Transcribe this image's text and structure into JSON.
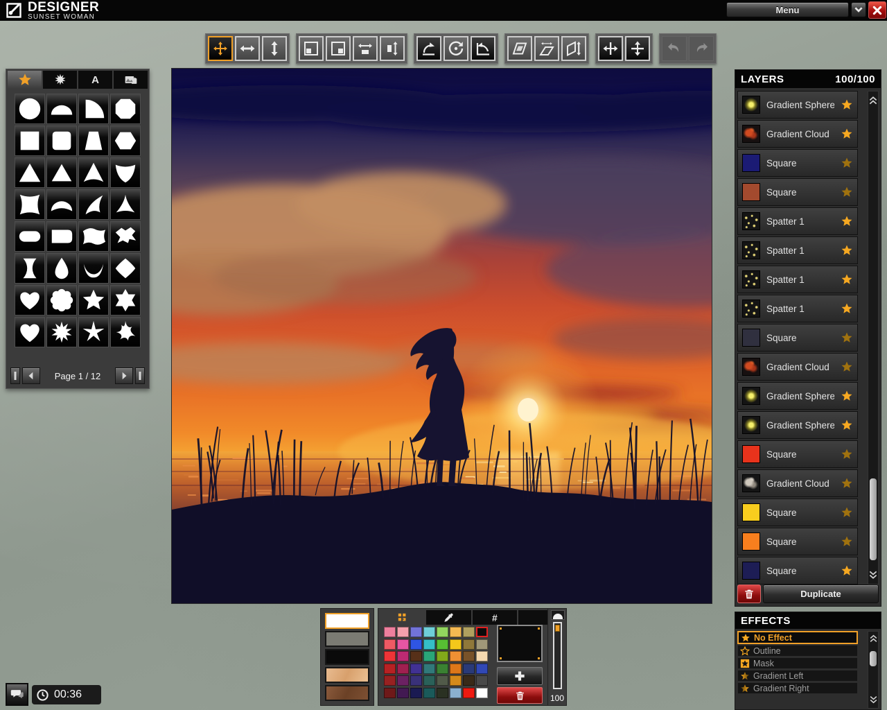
{
  "app": {
    "title": "DESIGNER",
    "subtitle": "SUNSET WOMAN"
  },
  "menu": {
    "label": "Menu"
  },
  "toolbar": {
    "groups": [
      {
        "name": "move",
        "buttons": [
          {
            "icon": "move",
            "state": "selected"
          },
          {
            "icon": "move-horizontal",
            "state": "normal"
          },
          {
            "icon": "move-vertical",
            "state": "normal"
          }
        ]
      },
      {
        "name": "scale",
        "buttons": [
          {
            "icon": "scale",
            "state": "normal"
          },
          {
            "icon": "scale-corner",
            "state": "normal"
          },
          {
            "icon": "scale-horizontal",
            "state": "normal"
          },
          {
            "icon": "scale-vertical",
            "state": "normal"
          }
        ]
      },
      {
        "name": "rotate",
        "buttons": [
          {
            "icon": "rotate-cw",
            "state": "dark"
          },
          {
            "icon": "rotate-free",
            "state": "normal"
          },
          {
            "icon": "rotate-ccw",
            "state": "dark"
          }
        ]
      },
      {
        "name": "skew",
        "buttons": [
          {
            "icon": "skew",
            "state": "normal"
          },
          {
            "icon": "skew-horizontal",
            "state": "normal"
          },
          {
            "icon": "skew-vertical",
            "state": "normal"
          }
        ]
      },
      {
        "name": "flip",
        "buttons": [
          {
            "icon": "flip-horizontal",
            "state": "dark"
          },
          {
            "icon": "flip-vertical",
            "state": "dark"
          }
        ]
      },
      {
        "name": "history",
        "buttons": [
          {
            "icon": "undo",
            "state": "disabled"
          },
          {
            "icon": "redo",
            "state": "disabled"
          }
        ]
      }
    ]
  },
  "shapes_panel": {
    "tabs": [
      {
        "name": "shapes",
        "icon": "star-tab",
        "active": true,
        "label": ""
      },
      {
        "name": "spatters",
        "icon": "spatter-tab",
        "active": false,
        "label": ""
      },
      {
        "name": "text",
        "icon": "text-tab",
        "active": false,
        "label": "A"
      },
      {
        "name": "images",
        "icon": "image-tab",
        "active": false,
        "label": ""
      }
    ],
    "shapes": [
      "circle",
      "semicircle",
      "quarter-circle",
      "octagon",
      "square",
      "rounded-square",
      "trapezoid",
      "hexagon",
      "triangle",
      "triangle-soft",
      "concave-triangle",
      "shield",
      "concave-square",
      "concave-arch",
      "swoosh",
      "three-point-star",
      "pill",
      "rounded-flag",
      "wavy-banner",
      "torn-banner",
      "concave-pillar",
      "teardrop",
      "crescent",
      "rounded-diamond",
      "heart",
      "flower",
      "star-5",
      "star-6",
      "heart-round",
      "burst-10",
      "star-5-sharp",
      "pinwheel-star"
    ],
    "pager": {
      "label": "Page 1 / 12"
    }
  },
  "layers": {
    "title": "LAYERS",
    "count": "100/100",
    "duplicate_label": "Duplicate",
    "items": [
      {
        "name": "Gradient Sphere",
        "thumb": "sphere",
        "star": "full"
      },
      {
        "name": "Gradient Cloud",
        "thumb": "cloud-red",
        "star": "full"
      },
      {
        "name": "Square",
        "thumb": "#1b1b74",
        "star": "dim"
      },
      {
        "name": "Square",
        "thumb": "#a34a2e",
        "star": "dim"
      },
      {
        "name": "Spatter 1",
        "thumb": "spatter",
        "star": "full"
      },
      {
        "name": "Spatter 1",
        "thumb": "spatter",
        "star": "full"
      },
      {
        "name": "Spatter 1",
        "thumb": "spatter",
        "star": "full"
      },
      {
        "name": "Spatter 1",
        "thumb": "spatter",
        "star": "full"
      },
      {
        "name": "Square",
        "thumb": "#30303f",
        "star": "dim"
      },
      {
        "name": "Gradient Cloud",
        "thumb": "cloud-red",
        "star": "dim"
      },
      {
        "name": "Gradient Sphere",
        "thumb": "sphere",
        "star": "full"
      },
      {
        "name": "Gradient Sphere",
        "thumb": "sphere",
        "star": "full"
      },
      {
        "name": "Square",
        "thumb": "#e8331c",
        "star": "dim"
      },
      {
        "name": "Gradient Cloud",
        "thumb": "cloud-gray",
        "star": "dim"
      },
      {
        "name": "Square",
        "thumb": "#f8cd1e",
        "star": "dim"
      },
      {
        "name": "Square",
        "thumb": "#f87f1e",
        "star": "dim"
      },
      {
        "name": "Square",
        "thumb": "#1d1d55",
        "star": "full"
      }
    ]
  },
  "effects": {
    "title": "EFFECTS",
    "items": [
      {
        "label": "No Effect",
        "icon": "star-filled",
        "selected": true
      },
      {
        "label": "Outline",
        "icon": "star-outline",
        "selected": false
      },
      {
        "label": "Mask",
        "icon": "star-square",
        "selected": false
      },
      {
        "label": "Gradient Left",
        "icon": "star-gradient-left",
        "selected": false
      },
      {
        "label": "Gradient Right",
        "icon": "star-gradient-right",
        "selected": false
      }
    ]
  },
  "swatch_stack": [
    {
      "name": "white",
      "color": "#ffffff",
      "selected": true
    },
    {
      "name": "gray",
      "color": "#7b7b73",
      "selected": false
    },
    {
      "name": "black",
      "color": "#0a0a0a",
      "selected": false
    },
    {
      "name": "skin-light",
      "color": "texture-light",
      "selected": false
    },
    {
      "name": "skin-dark",
      "color": "texture-dark",
      "selected": false
    }
  ],
  "color_panel": {
    "hex_tab_label": "#",
    "selected_color": "#0b0b0b",
    "opacity_value": "100",
    "selected_cell": {
      "row": 0,
      "col": 7
    },
    "grid": [
      [
        "#ee7f9d",
        "#f5a0ac",
        "#7273d8",
        "#6fcfd8",
        "#92d55e",
        "#f4b952",
        "#b0a05f",
        "#0b0b0b"
      ],
      [
        "#ee5a64",
        "#e756a3",
        "#2f55e4",
        "#35bfc8",
        "#57bf33",
        "#f4c81b",
        "#8f783a",
        "#a09879"
      ],
      [
        "#ee3437",
        "#bc2a72",
        "#573019",
        "#2aa578",
        "#82a81a",
        "#ee9033",
        "#785229",
        "#f5d9af"
      ],
      [
        "#b72123",
        "#a02050",
        "#413193",
        "#31797a",
        "#3a8132",
        "#dd7719",
        "#2a3a78",
        "#3148b5"
      ],
      [
        "#972121",
        "#6b2162",
        "#393179",
        "#2a6159",
        "#515a49",
        "#d48a1a",
        "#392a19",
        "#494949"
      ],
      [
        "#6e1919",
        "#421952",
        "#1a1a52",
        "#1a5a5a",
        "#2a3122",
        "#8ab0cf",
        "#ee1a11",
        "#ffffff"
      ]
    ]
  },
  "status": {
    "timer": "00:36"
  },
  "accent_colors": {
    "orange": "#f0a028",
    "star": "#f6a821",
    "selection_red": "#e02020"
  }
}
